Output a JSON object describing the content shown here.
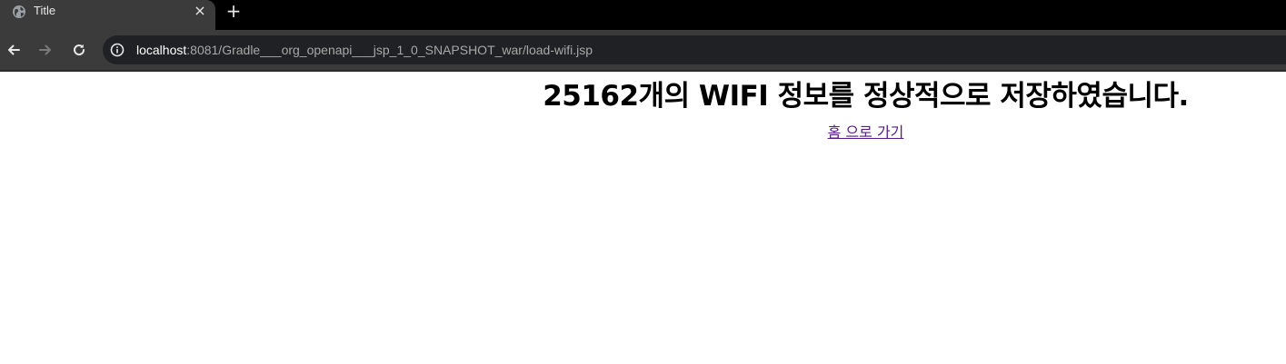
{
  "tab": {
    "title": "Title",
    "close_icon": "×",
    "new_tab_icon": "+"
  },
  "toolbar": {
    "url_host": "localhost",
    "url_path": ":8081/Gradle___org_openapi___jsp_1_0_SNAPSHOT_war/load-wifi.jsp"
  },
  "page": {
    "message": "25162개의 WIFI 정보를 정상적으로 저장하였습니다.",
    "home_link": "홈 으로 가기"
  },
  "colors": {
    "tabstrip": "#000000",
    "toolbar": "#3b3b3b",
    "omnibox": "#202124",
    "visited_link": "#551a8b"
  }
}
